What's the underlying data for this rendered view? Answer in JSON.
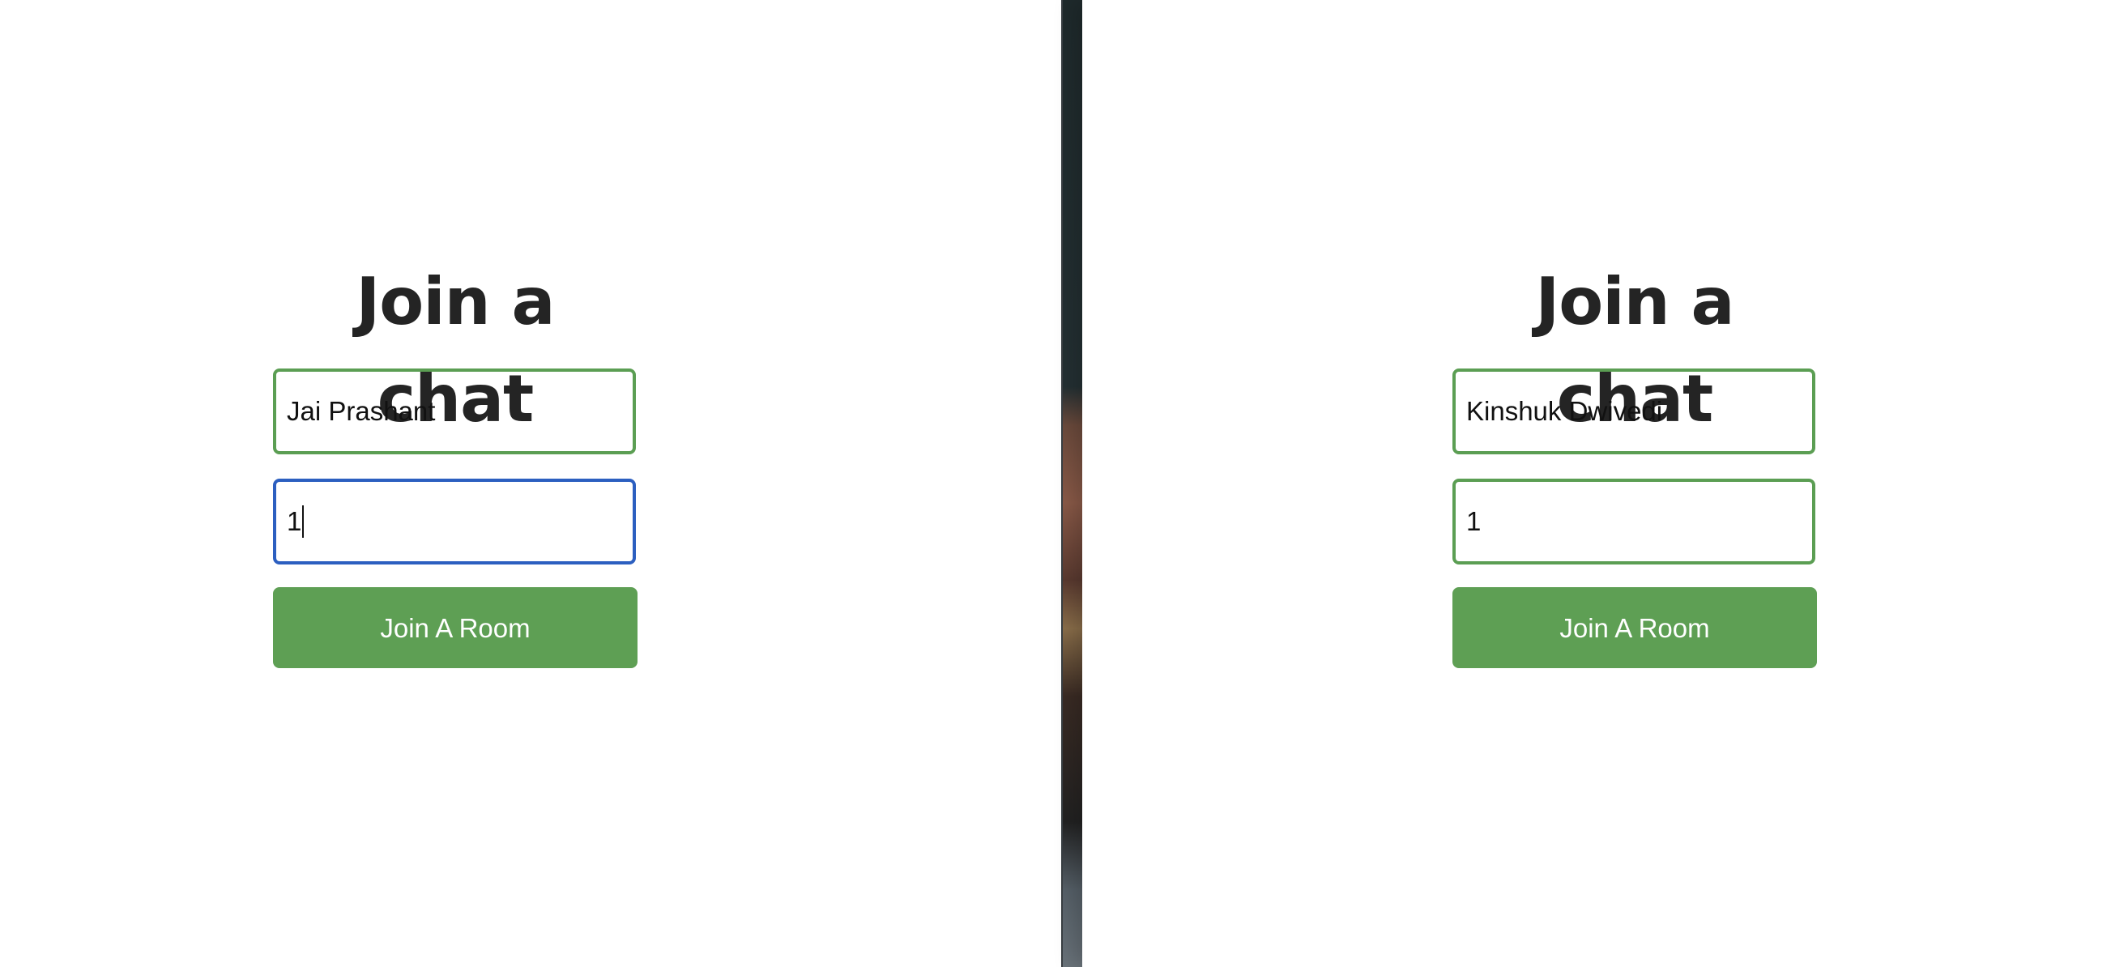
{
  "left_window": {
    "heading": "Join a chat",
    "name_input": {
      "value": "Jai Prashant"
    },
    "room_input": {
      "value": "1"
    },
    "join_button_label": "Join A Room"
  },
  "right_window": {
    "heading": "Join a chat",
    "name_input": {
      "value": "Kinshuk Dwivedi"
    },
    "room_input": {
      "value": "1"
    },
    "join_button_label": "Join A Room"
  },
  "colors": {
    "heading": "#242424",
    "input_border_valid": "#5b9e53",
    "input_border_focused": "#2c5fc0",
    "button_background": "#5e9f54",
    "button_text": "#ffffff"
  }
}
